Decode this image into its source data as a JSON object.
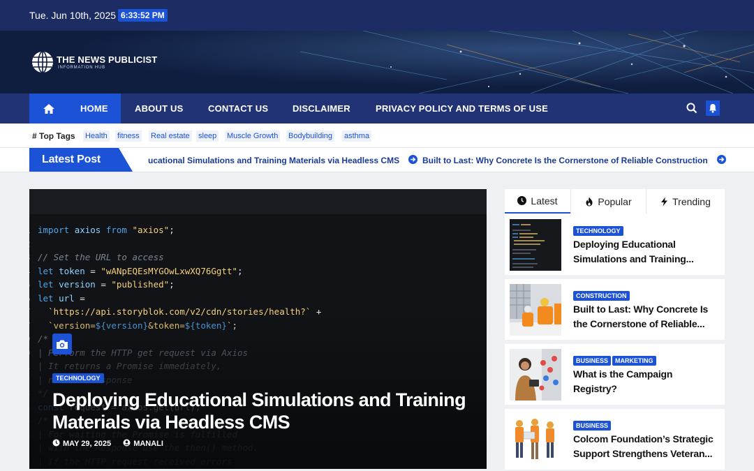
{
  "topbar": {
    "date": "Tue. Jun 10th, 2025",
    "time": "6:33:52 PM"
  },
  "site": {
    "name": "THE NEWS PUBLICIST",
    "tagline": "INFORMATION HUB"
  },
  "nav": {
    "items": [
      "HOME",
      "ABOUT US",
      "CONTACT US",
      "DISCLAIMER",
      "PRIVACY POLICY AND TERMS OF USE"
    ],
    "active": "HOME"
  },
  "tags": {
    "label": "Top Tags",
    "items": [
      "Health",
      "fitness",
      "Real estate",
      "sleep",
      "Muscle Growth",
      "Bodybuilding",
      "asthma"
    ]
  },
  "ticker": {
    "label": "Latest Post",
    "items": [
      "ucational Simulations and Training Materials via Headless CMS",
      "Built to Last: Why Concrete Is the Cornerstone of Reliable Construction"
    ]
  },
  "hero": {
    "category": "TECHNOLOGY",
    "title": "Deploying Educational Simulations and Training Materials via Headless CMS",
    "date": "MAY 29, 2025",
    "author": "MANALI"
  },
  "sidebar": {
    "tabs": [
      "Latest",
      "Popular",
      "Trending"
    ],
    "posts": [
      {
        "categories": [
          "TECHNOLOGY"
        ],
        "title": "Deploying Educational Simulations and Training..."
      },
      {
        "categories": [
          "CONSTRUCTION"
        ],
        "title": "Built to Last: Why Concrete Is the Cornerstone of Reliable..."
      },
      {
        "categories": [
          "BUSINESS",
          "MARKETING"
        ],
        "title": "What is the Campaign Registry?"
      },
      {
        "categories": [
          "BUSINESS"
        ],
        "title": "Colcom Foundation’s Strategic Support Strengthens Veteran..."
      }
    ]
  },
  "colors": {
    "brand": "#1b52d6",
    "nav": "#213374",
    "topbar": "#1d2c63"
  }
}
